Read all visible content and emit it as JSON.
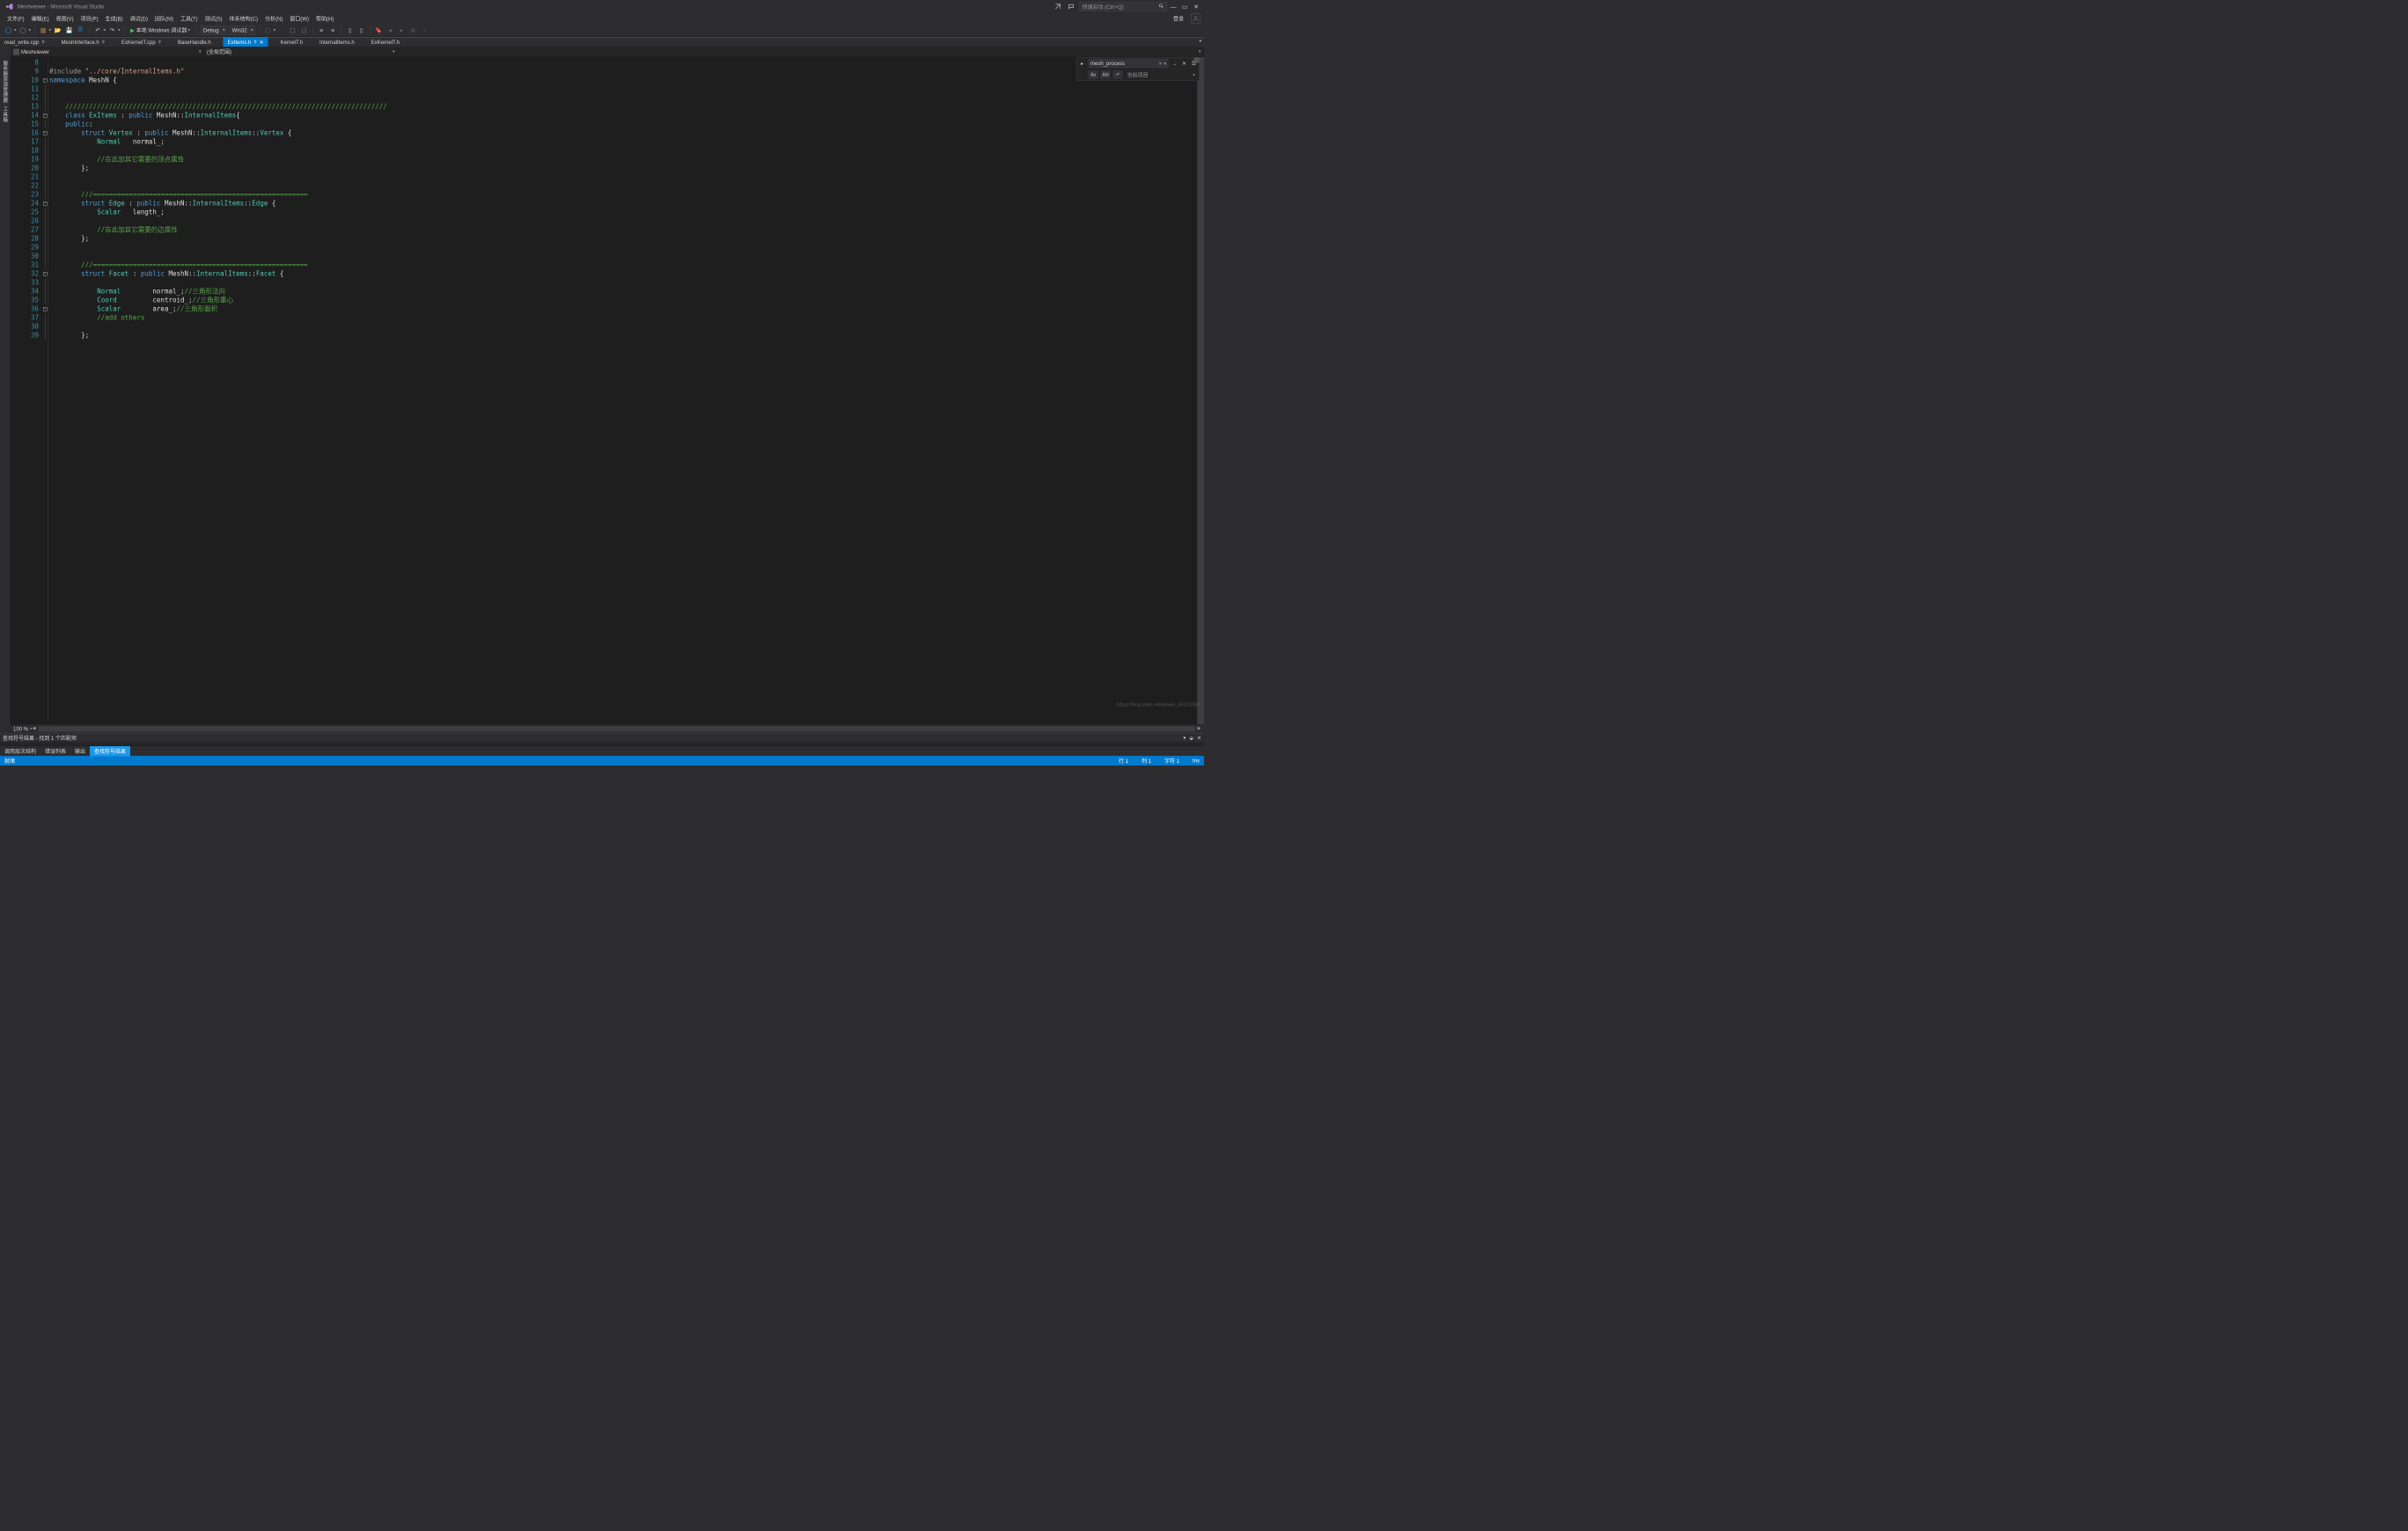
{
  "title": "Meshviewer - Microsoft Visual Studio",
  "quickLaunchPlaceholder": "快速启动 (Ctrl+Q)",
  "login": "登录",
  "menubar": [
    "文件(F)",
    "编辑(E)",
    "视图(V)",
    "项目(P)",
    "生成(B)",
    "调试(D)",
    "团队(M)",
    "工具(T)",
    "测试(S)",
    "体系结构(C)",
    "分析(N)",
    "窗口(W)",
    "帮助(H)"
  ],
  "debugButton": "本地 Windows 调试器",
  "configCombo": "Debug",
  "platformCombo": "Win32",
  "tabs": [
    {
      "label": "read_write.cpp",
      "pinned": true,
      "active": false
    },
    {
      "label": "MeshInterface.h",
      "pinned": true,
      "active": false
    },
    {
      "label": "ExKernelT.cpp",
      "pinned": true,
      "active": false
    },
    {
      "label": "BaseHandle.h",
      "pinned": false,
      "active": false
    },
    {
      "label": "ExItems.h",
      "pinned": true,
      "active": true,
      "close": true
    },
    {
      "label": "KernelT.h",
      "pinned": false,
      "active": false
    },
    {
      "label": "InternalItems.h",
      "pinned": false,
      "active": false
    },
    {
      "label": "ExKernelT.h",
      "pinned": false,
      "active": false
    }
  ],
  "navCombo1": "Meshviewer",
  "navCombo2": "(全局范围)",
  "sideTabs": [
    "服务器资源管理器",
    "工具箱"
  ],
  "find": {
    "value": "mesh_process",
    "scope": "当前项目",
    "aa": "Aa",
    "ab": "Abl",
    "re": "•*"
  },
  "zoom": "100 %",
  "panelHeader": "查找符号结果 - 找到 1 个匹配项",
  "panelTabs": [
    {
      "label": "调用层次结构",
      "active": false
    },
    {
      "label": "错误列表",
      "active": false
    },
    {
      "label": "输出",
      "active": false
    },
    {
      "label": "查找符号结果",
      "active": true
    }
  ],
  "status": {
    "ready": "就绪",
    "line": "行 1",
    "col": "列 1",
    "char": "字符 1",
    "ins": "Ins"
  },
  "watermark": "https://blog.csdn.net/weixin_44210088",
  "code": {
    "start": 8,
    "lines": [
      {
        "n": 8,
        "f": "",
        "seg": [
          [
            "",
            ""
          ]
        ]
      },
      {
        "n": 9,
        "f": "",
        "seg": [
          [
            "preproc",
            "#include "
          ],
          [
            "str",
            "\"../core/InternalItems.h\""
          ]
        ]
      },
      {
        "n": 10,
        "f": "box",
        "seg": [
          [
            "kw",
            "namespace"
          ],
          [
            "",
            " "
          ],
          [
            "ident",
            "MeshN"
          ],
          [
            "",
            " {"
          ]
        ]
      },
      {
        "n": 11,
        "f": "|",
        "seg": [
          [
            "",
            ""
          ]
        ]
      },
      {
        "n": 12,
        "f": "|",
        "seg": [
          [
            "",
            ""
          ]
        ]
      },
      {
        "n": 13,
        "f": "|",
        "seg": [
          [
            "",
            "    "
          ],
          [
            "cmt",
            "/////////////////////////////////////////////////////////////////////////////////"
          ]
        ]
      },
      {
        "n": 14,
        "f": "box",
        "seg": [
          [
            "",
            "    "
          ],
          [
            "kw",
            "class"
          ],
          [
            "",
            " "
          ],
          [
            "type",
            "ExItems"
          ],
          [
            "",
            " : "
          ],
          [
            "kw",
            "public"
          ],
          [
            "",
            " MeshN::"
          ],
          [
            "type",
            "InternalItems"
          ],
          [
            "",
            "{"
          ]
        ]
      },
      {
        "n": 15,
        "f": "|",
        "seg": [
          [
            "",
            "    "
          ],
          [
            "kw",
            "public"
          ],
          [
            "",
            ":"
          ]
        ]
      },
      {
        "n": 16,
        "f": "box",
        "seg": [
          [
            "",
            "        "
          ],
          [
            "kw",
            "struct"
          ],
          [
            "",
            " "
          ],
          [
            "type",
            "Vertex"
          ],
          [
            "",
            " : "
          ],
          [
            "kw",
            "public"
          ],
          [
            "",
            " MeshN::"
          ],
          [
            "type",
            "InternalItems"
          ],
          [
            "",
            "::"
          ],
          [
            "type",
            "Vertex"
          ],
          [
            "",
            " {"
          ]
        ]
      },
      {
        "n": 17,
        "f": "|",
        "seg": [
          [
            "",
            "            "
          ],
          [
            "type",
            "Normal"
          ],
          [
            "",
            "   normal_;"
          ]
        ]
      },
      {
        "n": 18,
        "f": "|",
        "seg": [
          [
            "",
            ""
          ]
        ]
      },
      {
        "n": 19,
        "f": "|",
        "seg": [
          [
            "",
            "            "
          ],
          [
            "cmt",
            "//在此加其它需要的顶点属性"
          ]
        ]
      },
      {
        "n": 20,
        "f": "|",
        "seg": [
          [
            "",
            "        };"
          ]
        ]
      },
      {
        "n": 21,
        "f": "|",
        "seg": [
          [
            "",
            ""
          ]
        ]
      },
      {
        "n": 22,
        "f": "|",
        "seg": [
          [
            "",
            ""
          ]
        ]
      },
      {
        "n": 23,
        "f": "|",
        "seg": [
          [
            "",
            "        "
          ],
          [
            "cmt",
            "///======================================================"
          ]
        ]
      },
      {
        "n": 24,
        "f": "box",
        "seg": [
          [
            "",
            "        "
          ],
          [
            "kw",
            "struct"
          ],
          [
            "",
            " "
          ],
          [
            "type",
            "Edge"
          ],
          [
            "",
            " : "
          ],
          [
            "kw",
            "public"
          ],
          [
            "",
            " MeshN::"
          ],
          [
            "type",
            "InternalItems"
          ],
          [
            "",
            "::"
          ],
          [
            "type",
            "Edge"
          ],
          [
            "",
            " {"
          ]
        ]
      },
      {
        "n": 25,
        "f": "|",
        "seg": [
          [
            "",
            "            "
          ],
          [
            "type",
            "Scalar"
          ],
          [
            "",
            "   length_;"
          ]
        ]
      },
      {
        "n": 26,
        "f": "|",
        "seg": [
          [
            "",
            ""
          ]
        ]
      },
      {
        "n": 27,
        "f": "|",
        "seg": [
          [
            "",
            "            "
          ],
          [
            "cmt",
            "//在此加其它需要的边属性"
          ]
        ]
      },
      {
        "n": 28,
        "f": "|",
        "seg": [
          [
            "",
            "        };"
          ]
        ]
      },
      {
        "n": 29,
        "f": "|",
        "seg": [
          [
            "",
            ""
          ]
        ]
      },
      {
        "n": 30,
        "f": "|",
        "seg": [
          [
            "",
            ""
          ]
        ]
      },
      {
        "n": 31,
        "f": "|",
        "seg": [
          [
            "",
            "        "
          ],
          [
            "cmt",
            "///======================================================"
          ]
        ]
      },
      {
        "n": 32,
        "f": "box",
        "seg": [
          [
            "",
            "        "
          ],
          [
            "kw",
            "struct"
          ],
          [
            "",
            " "
          ],
          [
            "type",
            "Facet"
          ],
          [
            "",
            " : "
          ],
          [
            "kw",
            "public"
          ],
          [
            "",
            " MeshN::"
          ],
          [
            "type",
            "InternalItems"
          ],
          [
            "",
            "::"
          ],
          [
            "type",
            "Facet"
          ],
          [
            "",
            " {"
          ]
        ]
      },
      {
        "n": 33,
        "f": "|",
        "seg": [
          [
            "",
            ""
          ]
        ]
      },
      {
        "n": 34,
        "f": "|",
        "seg": [
          [
            "",
            "            "
          ],
          [
            "type",
            "Normal"
          ],
          [
            "",
            "        normal_;"
          ],
          [
            "cmt",
            "//三角形法向"
          ]
        ]
      },
      {
        "n": 35,
        "f": "|",
        "seg": [
          [
            "",
            "            "
          ],
          [
            "type",
            "Coord"
          ],
          [
            "",
            "         centroid_;"
          ],
          [
            "cmt",
            "//三角形重心"
          ]
        ]
      },
      {
        "n": 36,
        "f": "box",
        "seg": [
          [
            "",
            "            "
          ],
          [
            "type",
            "Scalar"
          ],
          [
            "",
            "        area_;"
          ],
          [
            "cmt",
            "//三角形面积"
          ]
        ]
      },
      {
        "n": 37,
        "f": "|",
        "seg": [
          [
            "",
            "            "
          ],
          [
            "cmt",
            "//add others"
          ]
        ]
      },
      {
        "n": 38,
        "f": "|",
        "seg": [
          [
            "",
            ""
          ]
        ]
      },
      {
        "n": 39,
        "f": "|",
        "seg": [
          [
            "",
            "        };"
          ]
        ]
      }
    ]
  }
}
